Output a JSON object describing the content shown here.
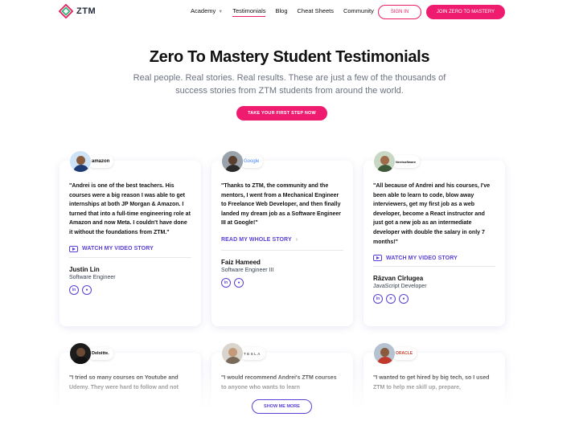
{
  "nav": {
    "logo_text": "ZTM",
    "links": [
      {
        "label": "Academy",
        "has_dropdown": true
      },
      {
        "label": "Testimonials",
        "active": true
      },
      {
        "label": "Blog"
      },
      {
        "label": "Cheat Sheets"
      },
      {
        "label": "Community"
      }
    ],
    "signin_label": "SIGN IN",
    "join_label": "JOIN ZERO TO MASTERY"
  },
  "hero": {
    "title": "Zero To Mastery Student Testimonials",
    "subtitle": "Real people. Real stories. Real results. These are just a few of the thousands of success stories from ZTM students from around the world.",
    "cta_label": "TAKE YOUR FIRST STEP NOW"
  },
  "testimonials": [
    {
      "company": "amazon",
      "quote": "\"Andrei is one of the best teachers. His courses were a big reason I was able to get internships at both JP Morgan & Amazon. I turned that into a full-time engineering role at Amazon and now Meta. I couldn't have done it without the foundations from ZTM.\"",
      "link_label": "WATCH MY VIDEO STORY",
      "name": "Justin Lin",
      "role": "Software Engineer",
      "socials": [
        "linkedin-icon",
        "github-icon"
      ]
    },
    {
      "company": "Google",
      "quote": "\"Thanks to ZTM, the community and the mentors, I went from a Mechanical Engineer to Freelance Web Developer, and then finally landed my dream job as a Software Engineer III at Google!\"",
      "link_label": "READ MY WHOLE STORY",
      "name": "Faiz Hameed",
      "role": "Software Engineer III",
      "socials": [
        "linkedin-icon",
        "github-icon"
      ]
    },
    {
      "company": "Nextsoftware",
      "quote": "\"All because of Andrei and his courses, I've been able to learn to code, blow away interviewers, get my first job as a web developer, become a React instructor and just got a new job as an intermediate developer with double the salary in only 7 months!\"",
      "link_label": "WATCH MY VIDEO STORY",
      "name": "Răzvan Cîrlugea",
      "role": "JavaScript Developer",
      "socials": [
        "linkedin-icon",
        "x-icon",
        "github-icon"
      ]
    },
    {
      "company": "Deloitte.",
      "quote": "\"I tried so many courses on Youtube and Udemy. They were hard to follow and not",
      "link_label": "",
      "name": "",
      "role": "",
      "socials": []
    },
    {
      "company": "TESLA",
      "quote": "\"I would recommend Andrei's ZTM courses to anyone who wants to learn",
      "link_label": "",
      "name": "",
      "role": "",
      "socials": []
    },
    {
      "company": "ORACLE",
      "quote": "\"I wanted to get hired by big tech, so I used ZTM to help me skill up, prepare,",
      "link_label": "",
      "name": "",
      "role": "",
      "socials": []
    }
  ],
  "show_more_label": "SHOW ME MORE",
  "colors": {
    "brand_pink": "#ee1b6e",
    "brand_purple": "#5b3fd6"
  }
}
